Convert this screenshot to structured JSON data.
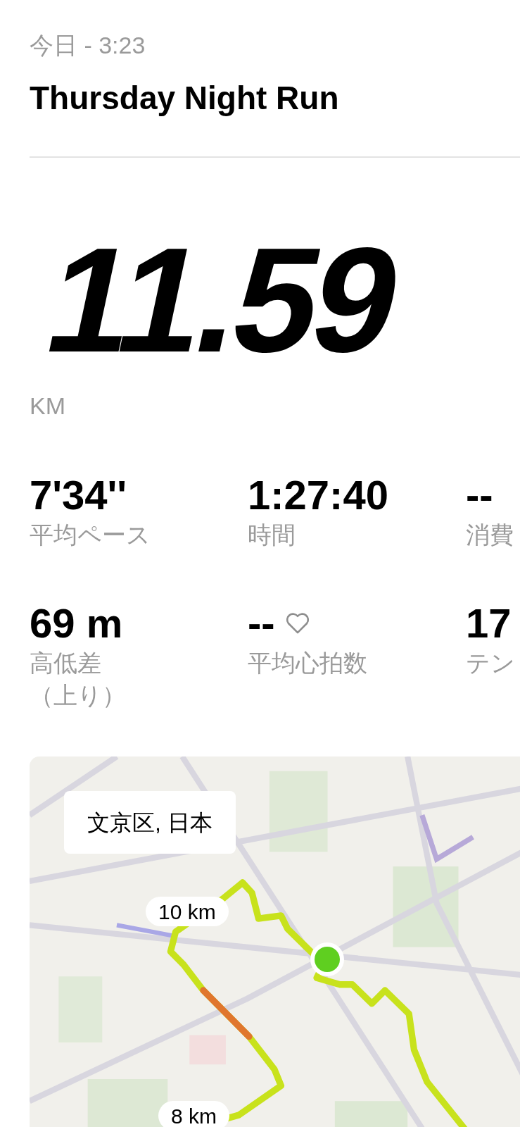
{
  "header": {
    "date": "今日 - 3:23",
    "title": "Thursday Night Run"
  },
  "distance": {
    "value": "11.59",
    "unit": "KM"
  },
  "stats": [
    {
      "kind": "plain",
      "value": "7'34''",
      "label_lines": [
        "平均ペース"
      ]
    },
    {
      "kind": "plain",
      "value": "1:27:40",
      "label_lines": [
        "時間"
      ]
    },
    {
      "kind": "plain",
      "value": "--",
      "label_lines": [
        "消費"
      ]
    },
    {
      "kind": "plain",
      "value": "69 m",
      "label_lines": [
        "高低差",
        "（上り）"
      ]
    },
    {
      "kind": "heart_rate",
      "value": "--",
      "label_lines": [
        "平均心拍数"
      ]
    },
    {
      "kind": "plain",
      "value": "17",
      "label_lines": [
        "テン"
      ]
    }
  ],
  "map": {
    "location": "文京区, 日本",
    "markers": [
      {
        "label": "10 km"
      },
      {
        "label": "8 km"
      }
    ]
  }
}
